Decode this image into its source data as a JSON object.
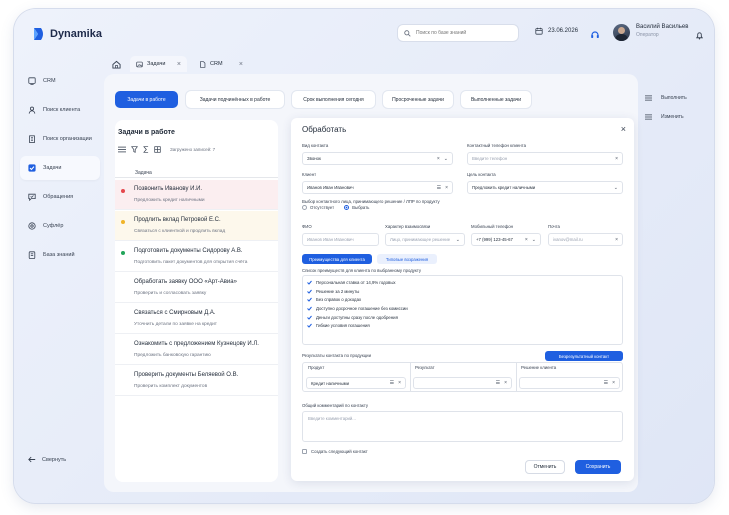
{
  "app": {
    "name": "Dynamika"
  },
  "header": {
    "search_placeholder": "Поиск по базе знаний",
    "date": "23.06.2026",
    "user_name": "Василий Васильев",
    "user_role": "Оператор"
  },
  "sidebar": {
    "items": [
      {
        "label": "CRM",
        "icon": "crm-icon"
      },
      {
        "label": "Поиск клиента",
        "icon": "user-icon"
      },
      {
        "label": "Поиск организации",
        "icon": "building-icon"
      },
      {
        "label": "Задачи",
        "icon": "checkbox-icon",
        "active": true
      },
      {
        "label": "Обращения",
        "icon": "message-icon"
      },
      {
        "label": "Суфлёр",
        "icon": "prompter-icon"
      },
      {
        "label": "База знаний",
        "icon": "book-icon"
      }
    ],
    "collapse_label": "Свернуть"
  },
  "tabs": [
    {
      "label": "Задачи",
      "active": true
    },
    {
      "label": "CRM",
      "active": false
    }
  ],
  "filters": [
    {
      "label": "Задачи в работе",
      "active": true
    },
    {
      "label": "Задачи подчинённых в работе"
    },
    {
      "label": "Срок выполнения сегодня"
    },
    {
      "label": "Просроченные задачи"
    },
    {
      "label": "Выполненные задачи"
    }
  ],
  "task_list": {
    "title": "Задачи в работе",
    "loaded": "Загружено записей: 7",
    "column": "Задача",
    "items": [
      {
        "title": "Позвонить Иванову И.И.",
        "subtitle": "Предложить кредит наличными",
        "status": "red"
      },
      {
        "title": "Продлить вклад Петровой Е.С.",
        "subtitle": "Связаться с клиенткой и продлить вклад",
        "status": "yellow"
      },
      {
        "title": "Подготовить документы Сидорову А.В.",
        "subtitle": "Подготовить пакет документов для открытия счёта",
        "status": "green"
      },
      {
        "title": "Обработать заявку ООО «Арт-Авиа»",
        "subtitle": "Проверить и согласовать заявку",
        "status": "none"
      },
      {
        "title": "Связаться с Смирновым Д.А.",
        "subtitle": "Уточнить детали по заявке на кредит",
        "status": "none"
      },
      {
        "title": "Ознакомить с предложением Кузнецову И.Л.",
        "subtitle": "Предложить банковскую гарантию",
        "status": "none"
      },
      {
        "title": "Проверить документы Беляевой О.В.",
        "subtitle": "Проверить комплект документов",
        "status": "none"
      }
    ]
  },
  "dialog": {
    "title": "Обработать",
    "contact_type_label": "Вид контакта",
    "contact_type_value": "Звонок",
    "phone_label": "Контактный телефон клиента",
    "phone_placeholder": "Введите телефон",
    "client_label": "Клиент",
    "client_value": "Иванов Иван Иванович",
    "goal_label": "Цель контакта",
    "goal_value": "Предложить кредит наличными",
    "choose_person_label": "Выбор контактного лица, принимающего решение / ЛПР по продукту",
    "radio_absent": "Отсутствует",
    "radio_choose": "Выбрать",
    "fio_label": "ФИО",
    "fio_placeholder": "Иванов Иван Иванович",
    "role_label": "Характер взаимосвязи",
    "role_placeholder": "Лицо, принимающее решение",
    "mobile_label": "Мобильный телефон",
    "mobile_value": "+7 (999) 123-45-67",
    "email_label": "Почта",
    "email_value": "ivanov@mail.ru",
    "btn_advantages": "Преимущества для клиента",
    "btn_objections": "Типовые возражения",
    "benefits_label": "Список преимуществ для клиента по выбранному продукту",
    "benefits": [
      "Персональная ставка от 14,9% годовых",
      "Решение за 2 минуты",
      "Без справок о доходах",
      "Доступно досрочное погашение без комиссии",
      "Деньги доступны сразу после одобрения",
      "Гибкие условия погашения"
    ],
    "results_label": "Результаты контакта по продукции",
    "btn_unsuccessful": "Безрезультатный контакт",
    "col_product": "Продукт",
    "col_result": "Результат",
    "col_decision": "Решение клиента",
    "product_value": "Кредит наличными",
    "comment_label": "Общий комментарий по контакту",
    "comment_placeholder": "Введите комментарий...",
    "next_contact": "Создать следующий контакт",
    "cancel": "Отменить",
    "save": "Сохранить"
  },
  "right_actions": [
    {
      "label": "Выполнить"
    },
    {
      "label": "Изменить"
    }
  ],
  "colors": {
    "accent": "#1f5fe0",
    "red": "#e5484d",
    "yellow": "#f0b429",
    "green": "#22a55a"
  }
}
